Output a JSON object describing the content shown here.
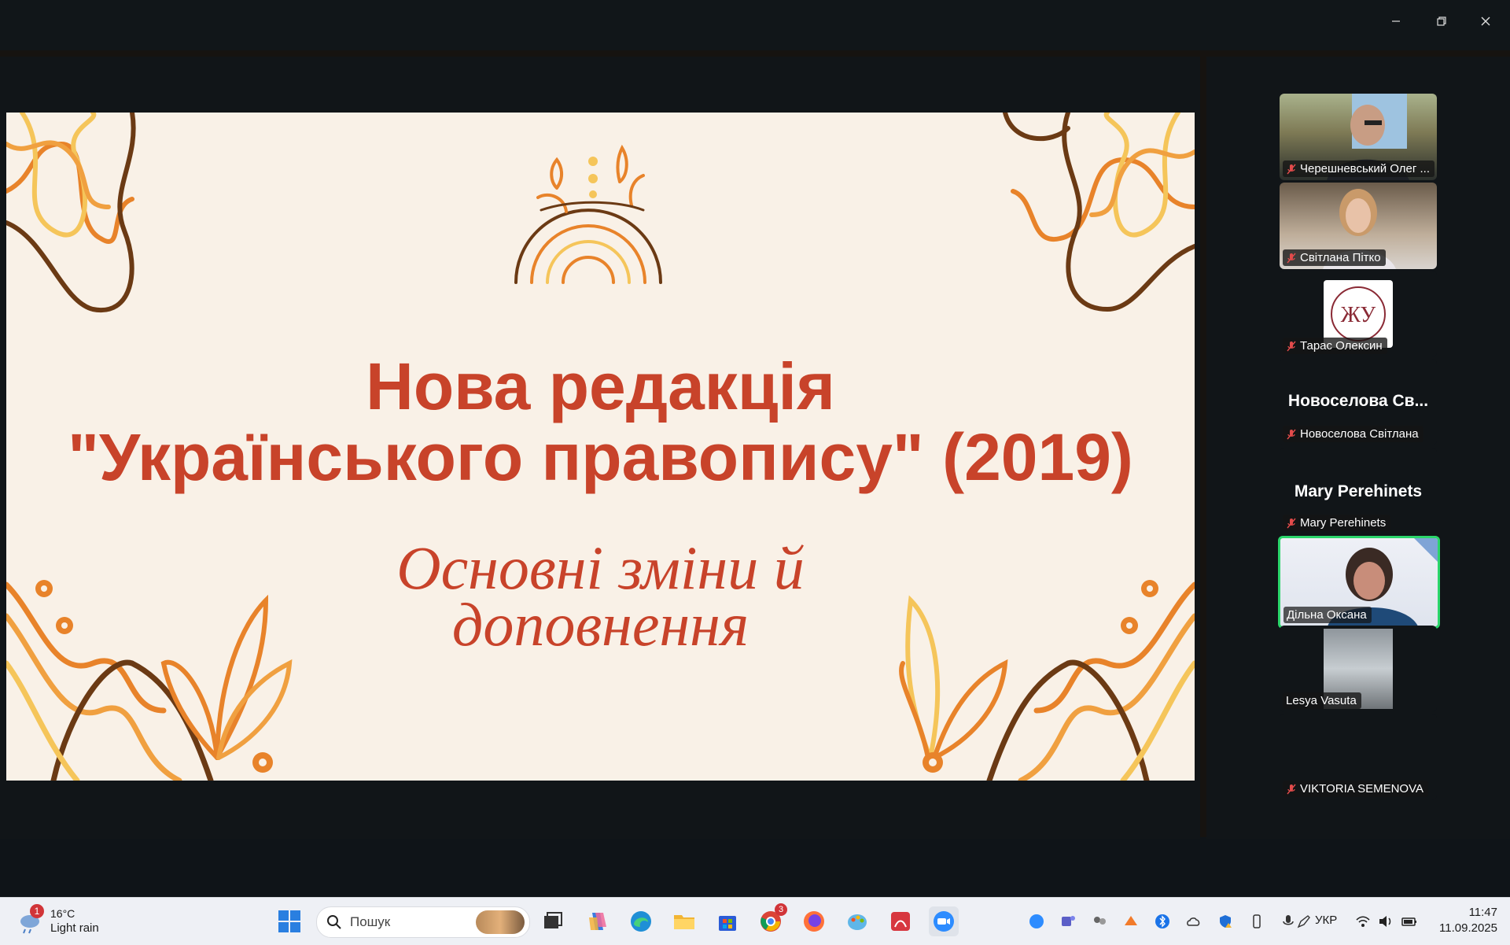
{
  "window": {
    "minimize_icon": "minimize-icon",
    "restore_icon": "restore-icon",
    "close_icon": "close-icon"
  },
  "slide": {
    "title_line1": "Нова редакція",
    "title_line2": "\"Українського правопису\" (2019)",
    "subtitle_line1": "Основні зміни й",
    "subtitle_line2": "доповнення",
    "colors": {
      "background": "#f9f1e7",
      "text": "#c8432a",
      "orange": "#e8832a",
      "dark_brown": "#6b3a14",
      "yellow": "#f5c55a"
    }
  },
  "participants": [
    {
      "name": "Черешневський Олег ...",
      "muted": true,
      "video": true
    },
    {
      "name": "Світлана Пітко",
      "muted": true,
      "video": true
    },
    {
      "name": "Тарас Олексин",
      "muted": true,
      "video": false,
      "avatar_text": "ЖУ"
    },
    {
      "display": "Новоселова  Св...",
      "name": "Новоселова Світлана",
      "muted": true,
      "video": false
    },
    {
      "display": "Mary Perehinets",
      "name": "Mary Perehinets",
      "muted": true,
      "video": false
    },
    {
      "name": "Дільна Оксана",
      "muted": false,
      "video": true,
      "active_speaker": true
    },
    {
      "name": "Lesya Vasuta",
      "muted": false,
      "video": true
    },
    {
      "name": "VIKTORIA SEMENOVA",
      "muted": true,
      "video": false
    }
  ],
  "taskbar": {
    "weather": {
      "badge": "1",
      "temp": "16°C",
      "condition": "Light rain"
    },
    "search_placeholder": "Пошук",
    "chrome_badge": "3",
    "language": "УКР",
    "time": "11:47",
    "date": "11.09.2025",
    "pinned": [
      "windows-start-icon",
      "search-icon",
      "task-view-icon",
      "copilot-icon",
      "edge-icon",
      "file-explorer-icon",
      "store-icon",
      "chrome-icon",
      "firefox-icon",
      "paint-icon",
      "acrobat-icon",
      "zoom-icon"
    ],
    "tray": [
      "zoom-tray-icon",
      "teams-icon",
      "people-icon",
      "onedrive-icon",
      "bluetooth-icon",
      "cloud-icon",
      "defender-icon",
      "usb-icon",
      "mic-icon",
      "pen-icon",
      "wifi-icon",
      "volume-icon",
      "battery-icon"
    ]
  }
}
